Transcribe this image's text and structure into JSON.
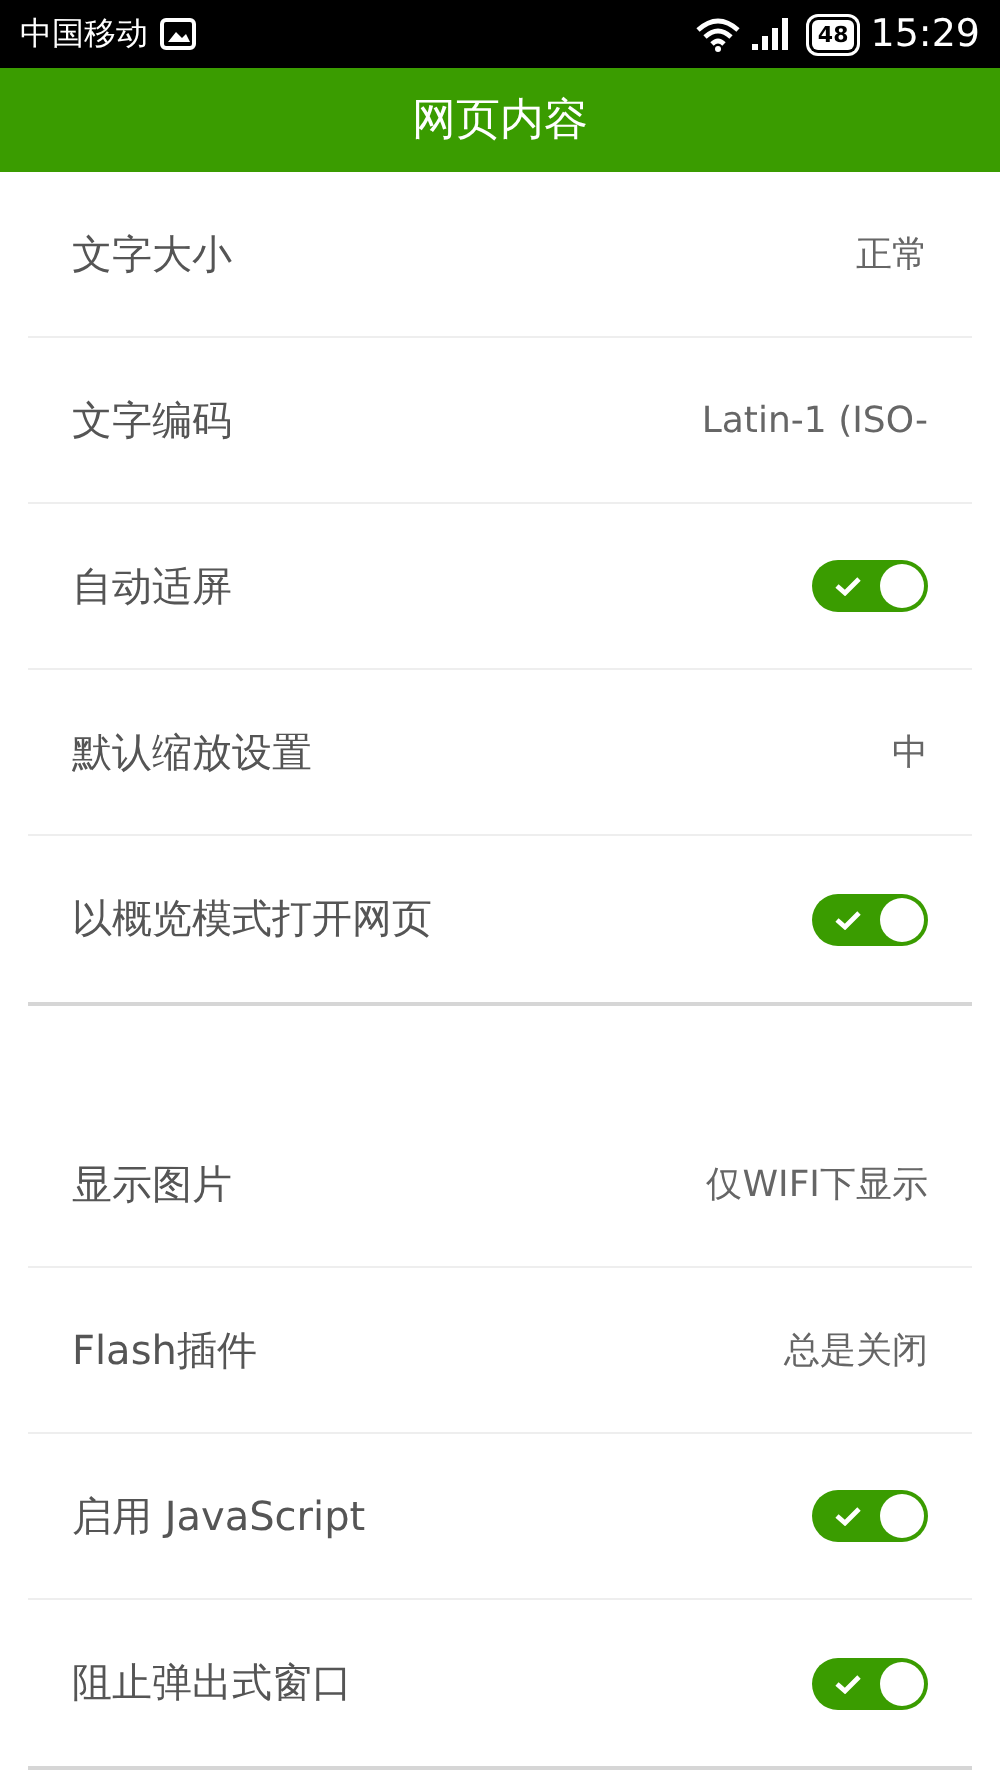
{
  "status_bar": {
    "carrier": "中国移动",
    "battery": "48",
    "time": "15:29"
  },
  "header": {
    "title": "网页内容"
  },
  "sections": [
    {
      "rows": [
        {
          "kind": "value",
          "label": "文字大小",
          "value": "正常"
        },
        {
          "kind": "value",
          "label": "文字编码",
          "value": "Latin-1 (ISO-"
        },
        {
          "kind": "toggle",
          "label": "自动适屏",
          "on": true
        },
        {
          "kind": "value",
          "label": "默认缩放设置",
          "value": "中"
        },
        {
          "kind": "toggle",
          "label": "以概览模式打开网页",
          "on": true
        }
      ]
    },
    {
      "rows": [
        {
          "kind": "value",
          "label": "显示图片",
          "value": "仅WIFI下显示"
        },
        {
          "kind": "value",
          "label": "Flash插件",
          "value": "总是关闭"
        },
        {
          "kind": "toggle",
          "label": "启用 JavaScript",
          "on": true
        },
        {
          "kind": "toggle",
          "label": "阻止弹出式窗口",
          "on": true
        }
      ]
    }
  ]
}
